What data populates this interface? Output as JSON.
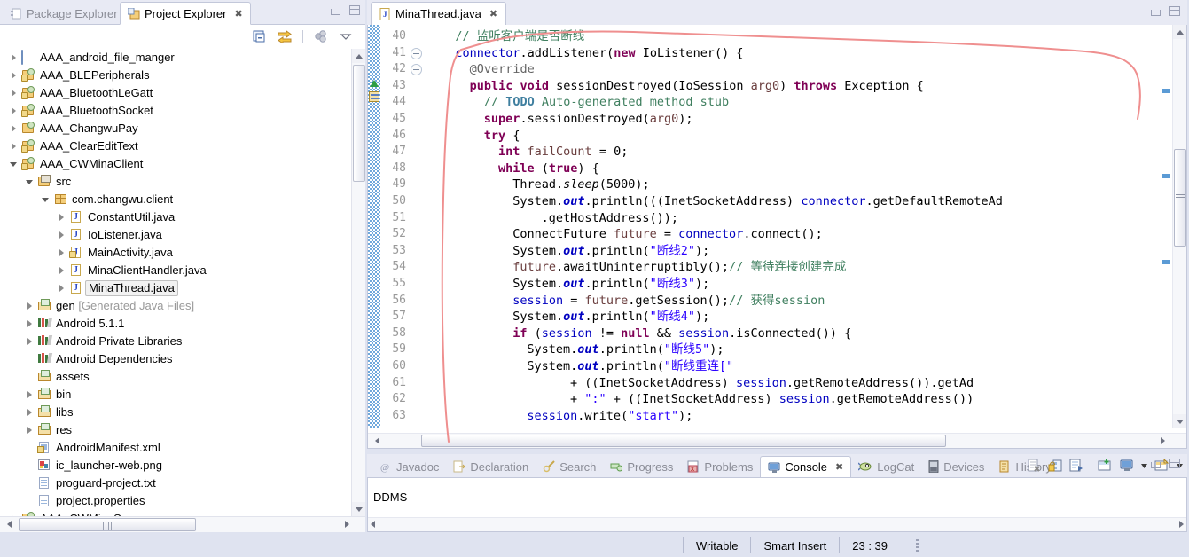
{
  "left_panel": {
    "tabs": [
      {
        "label": "Package Explorer",
        "icon": "package-explorer-icon",
        "active": false
      },
      {
        "label": "Project Explorer",
        "icon": "project-explorer-icon",
        "active": true,
        "close": "✖"
      }
    ],
    "toolbar": [
      {
        "name": "collapse-all-icon"
      },
      {
        "name": "link-with-editor-icon"
      },
      {
        "name": "focus-on-active-task-icon"
      },
      {
        "name": "view-menu-icon"
      }
    ],
    "tree": [
      {
        "label": "AAA_android_file_manger",
        "indent": 0,
        "arrow": "closed",
        "icon": "folder-plain-icon"
      },
      {
        "label": "AAA_BLEPeripherals",
        "indent": 0,
        "arrow": "closed",
        "icon": "java-project-warn-icon"
      },
      {
        "label": "AAA_BluetoothLeGatt",
        "indent": 0,
        "arrow": "closed",
        "icon": "java-project-warn-icon"
      },
      {
        "label": "AAA_BluetoothSocket",
        "indent": 0,
        "arrow": "closed",
        "icon": "java-project-warn-icon"
      },
      {
        "label": "AAA_ChangwuPay",
        "indent": 0,
        "arrow": "closed",
        "icon": "java-project-icon"
      },
      {
        "label": "AAA_ClearEditText",
        "indent": 0,
        "arrow": "closed",
        "icon": "java-project-warn-icon"
      },
      {
        "label": "AAA_CWMinaClient",
        "indent": 0,
        "arrow": "open",
        "icon": "java-project-warn-icon"
      },
      {
        "label": "src",
        "indent": 1,
        "arrow": "open",
        "icon": "source-folder-icon"
      },
      {
        "label": "com.changwu.client",
        "indent": 2,
        "arrow": "open",
        "icon": "package-icon"
      },
      {
        "label": "ConstantUtil.java",
        "indent": 3,
        "arrow": "closed",
        "icon": "java-file-icon"
      },
      {
        "label": "IoListener.java",
        "indent": 3,
        "arrow": "closed",
        "icon": "java-file-icon"
      },
      {
        "label": "MainActivity.java",
        "indent": 3,
        "arrow": "closed",
        "icon": "java-file-warn-icon"
      },
      {
        "label": "MinaClientHandler.java",
        "indent": 3,
        "arrow": "closed",
        "icon": "java-file-icon"
      },
      {
        "label": "MinaThread.java",
        "indent": 3,
        "arrow": "closed",
        "icon": "java-file-icon",
        "selected": true
      },
      {
        "label": "gen",
        "suffix": " [Generated Java Files]",
        "indent": 1,
        "arrow": "closed",
        "icon": "gen-folder-icon"
      },
      {
        "label": "Android 5.1.1",
        "indent": 1,
        "arrow": "closed",
        "icon": "library-icon"
      },
      {
        "label": "Android Private Libraries",
        "indent": 1,
        "arrow": "closed",
        "icon": "library-icon"
      },
      {
        "label": "Android Dependencies",
        "indent": 1,
        "arrow": "none",
        "icon": "library-icon"
      },
      {
        "label": "assets",
        "indent": 1,
        "arrow": "none",
        "icon": "folder-icon"
      },
      {
        "label": "bin",
        "indent": 1,
        "arrow": "closed",
        "icon": "folder-icon"
      },
      {
        "label": "libs",
        "indent": 1,
        "arrow": "closed",
        "icon": "folder-icon"
      },
      {
        "label": "res",
        "indent": 1,
        "arrow": "closed",
        "icon": "folder-icon"
      },
      {
        "label": "AndroidManifest.xml",
        "indent": 1,
        "arrow": "none",
        "icon": "xml-file-icon"
      },
      {
        "label": "ic_launcher-web.png",
        "indent": 1,
        "arrow": "none",
        "icon": "png-file-icon"
      },
      {
        "label": "proguard-project.txt",
        "indent": 1,
        "arrow": "none",
        "icon": "text-file-icon"
      },
      {
        "label": "project.properties",
        "indent": 1,
        "arrow": "none",
        "icon": "text-file-icon"
      },
      {
        "label": "AAA_CWMinaServer",
        "indent": 0,
        "arrow": "closed",
        "icon": "java-project-icon"
      }
    ]
  },
  "editor": {
    "tab": {
      "label": "MinaThread.java",
      "icon": "java-file-icon",
      "close": "✖"
    },
    "first_line": 40,
    "lines": [
      {
        "n": 40,
        "fold": false,
        "indent": 2,
        "html": "<span class='cm'>// </span><span class='cm'>监听客户端是否断线</span>"
      },
      {
        "n": 41,
        "fold": true,
        "indent": 2,
        "html": "<span class='fld'>connector</span>.addListener(<span class='kw'>new</span> IoListener() {"
      },
      {
        "n": 42,
        "fold": true,
        "indent": 3,
        "html": "<span class='cm' style='color:#646464'>@Override</span>"
      },
      {
        "n": 43,
        "fold": false,
        "indent": 3,
        "html": "<span class='kw'>public</span> <span class='kw'>void</span> sessionDestroyed(IoSession <span class='loc'>arg0</span>) <span class='kw'>throws</span> Exception {"
      },
      {
        "n": 44,
        "fold": false,
        "indent": 4,
        "html": "<span class='cm'>// </span><span class='todo'>TODO</span><span class='cm'> Auto-generated method stub</span>"
      },
      {
        "n": 45,
        "fold": false,
        "indent": 4,
        "html": "<span class='kw'>super</span>.sessionDestroyed(<span class='loc'>arg0</span>);"
      },
      {
        "n": 46,
        "fold": false,
        "indent": 4,
        "html": "<span class='kw'>try</span> {"
      },
      {
        "n": 47,
        "fold": false,
        "indent": 5,
        "html": "<span class='kw'>int</span> <span class='loc'>failCount</span> = 0;"
      },
      {
        "n": 48,
        "fold": false,
        "indent": 5,
        "html": "<span class='kw'>while</span> (<span class='kw'>true</span>) {"
      },
      {
        "n": 49,
        "fold": false,
        "indent": 6,
        "html": "Thread.<span class='stat'>sleep</span>(5000);"
      },
      {
        "n": 50,
        "fold": false,
        "indent": 6,
        "html": "System.<span class='statb'>out</span>.println(((InetSocketAddress) <span class='fld'>connector</span>.getDefaultRemoteAd"
      },
      {
        "n": 51,
        "fold": false,
        "indent": 8,
        "html": ".getHostAddress());"
      },
      {
        "n": 52,
        "fold": false,
        "indent": 6,
        "html": "ConnectFuture <span class='loc'>future</span> = <span class='fld'>connector</span>.connect();"
      },
      {
        "n": 53,
        "fold": false,
        "indent": 6,
        "html": "System.<span class='statb'>out</span>.println(<span class='str'>\"断线2\"</span>);"
      },
      {
        "n": 54,
        "fold": false,
        "indent": 6,
        "html": "<span class='loc'>future</span>.awaitUninterruptibly();<span class='cm'>// 等待连接创建完成</span>"
      },
      {
        "n": 55,
        "fold": false,
        "indent": 6,
        "html": "System.<span class='statb'>out</span>.println(<span class='str'>\"断线3\"</span>);"
      },
      {
        "n": 56,
        "fold": false,
        "indent": 6,
        "html": "<span class='fld'>session</span> = <span class='loc'>future</span>.getSession();<span class='cm'>// 获得session</span>"
      },
      {
        "n": 57,
        "fold": false,
        "indent": 6,
        "html": "System.<span class='statb'>out</span>.println(<span class='str'>\"断线4\"</span>);"
      },
      {
        "n": 58,
        "fold": false,
        "indent": 6,
        "html": "<span class='kw'>if</span> (<span class='fld'>session</span> != <span class='kw'>null</span> &amp;&amp; <span class='fld'>session</span>.isConnected()) {"
      },
      {
        "n": 59,
        "fold": false,
        "indent": 7,
        "html": "System.<span class='statb'>out</span>.println(<span class='str'>\"断线5\"</span>);"
      },
      {
        "n": 60,
        "fold": false,
        "indent": 7,
        "html": "System.<span class='statb'>out</span>.println(<span class='str'>\"断线重连[\"</span>"
      },
      {
        "n": 61,
        "fold": false,
        "indent": 10,
        "html": "+ ((InetSocketAddress) <span class='fld'>session</span>.getRemoteAddress()).getAd"
      },
      {
        "n": 62,
        "fold": false,
        "indent": 10,
        "html": "+ <span class='str'>\":\"</span> + ((InetSocketAddress) <span class='fld'>session</span>.getRemoteAddress())"
      },
      {
        "n": 63,
        "fold": false,
        "indent": 7,
        "html": "<span class='fld'>session</span>.write(<span class='str'>\"start\"</span>);"
      }
    ],
    "annotation_color": "#ef8f8f"
  },
  "console": {
    "tabs": [
      {
        "label": "Javadoc",
        "icon": "javadoc-icon",
        "active": false
      },
      {
        "label": "Declaration",
        "icon": "declaration-icon",
        "active": false
      },
      {
        "label": "Search",
        "icon": "search-icon",
        "active": false
      },
      {
        "label": "Progress",
        "icon": "progress-icon",
        "active": false
      },
      {
        "label": "Problems",
        "icon": "problems-icon",
        "active": false
      },
      {
        "label": "Console",
        "icon": "console-icon",
        "active": true,
        "close": "✖"
      },
      {
        "label": "LogCat",
        "icon": "logcat-icon",
        "active": false
      },
      {
        "label": "Devices",
        "icon": "devices-icon",
        "active": false
      },
      {
        "label": "History",
        "icon": "history-icon",
        "active": false
      }
    ],
    "toolbar": [
      {
        "name": "clear-console-icon"
      },
      {
        "name": "scroll-lock-icon"
      },
      {
        "name": "pin-console-icon"
      },
      {
        "name": "display-selected-console-icon"
      },
      {
        "name": "open-console-icon"
      },
      {
        "name": "open-console-dropdown-icon"
      },
      {
        "name": "new-console-view-icon"
      },
      {
        "name": "new-console-dropdown-icon"
      }
    ],
    "output": "DDMS"
  },
  "statusbar": {
    "writable": "Writable",
    "insert_mode": "Smart Insert",
    "position": "23 : 39"
  }
}
